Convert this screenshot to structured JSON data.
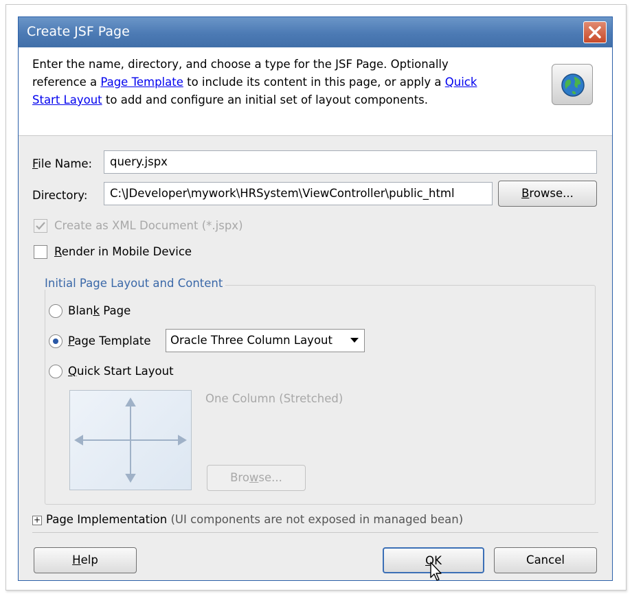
{
  "dialog": {
    "title": "Create JSF Page",
    "header": {
      "text_1": "Enter the name, directory, and choose a type for the JSF Page. Optionally",
      "text_2": "reference a ",
      "link_page_template": "Page Template",
      "text_3": " to include its content in this page, or apply a ",
      "link_quick": "Quick",
      "link_start_layout": "Start Layout",
      "text_4": " to add and configure an initial set of layout components."
    },
    "file_name": {
      "mnemonic": "F",
      "label_rest": "ile Name:",
      "value": "query.jspx"
    },
    "directory": {
      "label": "Directory:",
      "value": "C:\\JDeveloper\\mywork\\HRSystem\\ViewController\\public_html"
    },
    "browse_button": {
      "mnemonic": "B",
      "rest": "rowse..."
    },
    "xml_document": {
      "label": "Create as XML Document (*.jspx)",
      "checked": true,
      "enabled": false
    },
    "mobile": {
      "mnemonic": "R",
      "rest": "ender in Mobile Device",
      "checked": false
    },
    "layout_group": {
      "title": "Initial Page Layout and Content",
      "blank_page": {
        "before": "Blan",
        "mnemonic": "k",
        "after": " Page"
      },
      "page_template": {
        "mnemonic": "P",
        "rest": "age Template",
        "selected": true,
        "select_value": "Oracle Three Column Layout"
      },
      "quick_start": {
        "mnemonic": "Q",
        "rest": "uick Start Layout"
      },
      "layout_name": "One Column (Stretched)",
      "browse_disabled": {
        "before": "Bro",
        "mnemonic": "w",
        "after": "se..."
      }
    },
    "implementation": {
      "label": "Page Implementation",
      "note": " (UI components are not exposed in managed bean)"
    },
    "help_button": {
      "mnemonic": "H",
      "rest": "elp"
    },
    "ok_button": {
      "mnemonic": "O",
      "rest": "K"
    },
    "cancel_button": "Cancel"
  },
  "colors": {
    "title_bar": "#4c7ab4",
    "link": "#0000ee",
    "group_title": "#3a68a8",
    "radio_dot": "#2a58a6",
    "close": "#c84a2a"
  },
  "icons": [
    "close-icon",
    "globe-icon",
    "checkmark-icon",
    "dropdown-arrow-icon",
    "layout-arrows-icon",
    "expand-plus-icon",
    "mouse-cursor-icon"
  ]
}
